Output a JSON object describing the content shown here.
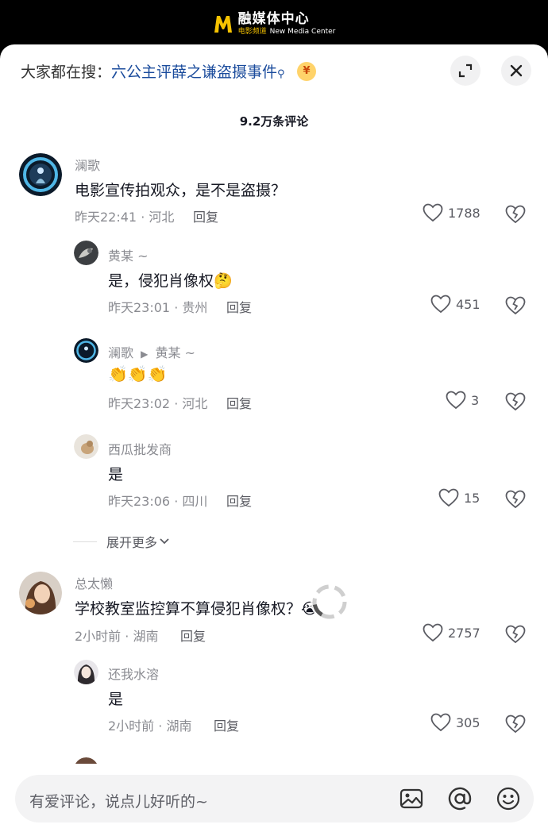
{
  "watermark": {
    "title": "融媒体中心",
    "sub_cn": "电影频道",
    "sub_en": "New Media Center"
  },
  "header": {
    "hot_prefix": "大家都在搜：",
    "hot_keyword": "六公主评薛之谦盗摄事件",
    "coin_glyph": "¥",
    "comment_count": "9.2万条评论"
  },
  "comments": [
    {
      "user": "澜歌",
      "text": "电影宣传拍观众，是不是盗摄？",
      "time": "昨天22:41 · 河北",
      "reply": "回复",
      "likes": "1788"
    },
    {
      "user": "黄某 ~",
      "text": "是，侵犯肖像权",
      "emoji": "🤔",
      "time": "昨天23:01 · 贵州",
      "reply": "回复",
      "likes": "451"
    },
    {
      "user": "澜歌",
      "arrow": "▶",
      "reply_to": "黄某 ~",
      "text": "👏👏👏",
      "time": "昨天23:02 · 河北",
      "reply": "回复",
      "likes": "3"
    },
    {
      "user": "西瓜批发商",
      "text": "是",
      "time": "昨天23:06 · 四川",
      "reply": "回复",
      "likes": "15"
    },
    {
      "user": "总太懒",
      "text": "学校教室监控算不算侵犯肖像权？",
      "emoji": "😭",
      "time": "2小时前 · 湖南",
      "reply": "回复",
      "likes": "2757"
    },
    {
      "user": "还我水溶",
      "text": "是",
      "time": "2小时前 · 湖南",
      "reply": "回复",
      "likes": "305"
    }
  ],
  "expand_more": "展开更多",
  "input": {
    "placeholder": "有爱评论，说点儿好听的~"
  },
  "colors": {
    "accent_link": "#1a4b9c",
    "muted": "#8a8b91",
    "sheet_bg": "#ffffff"
  }
}
